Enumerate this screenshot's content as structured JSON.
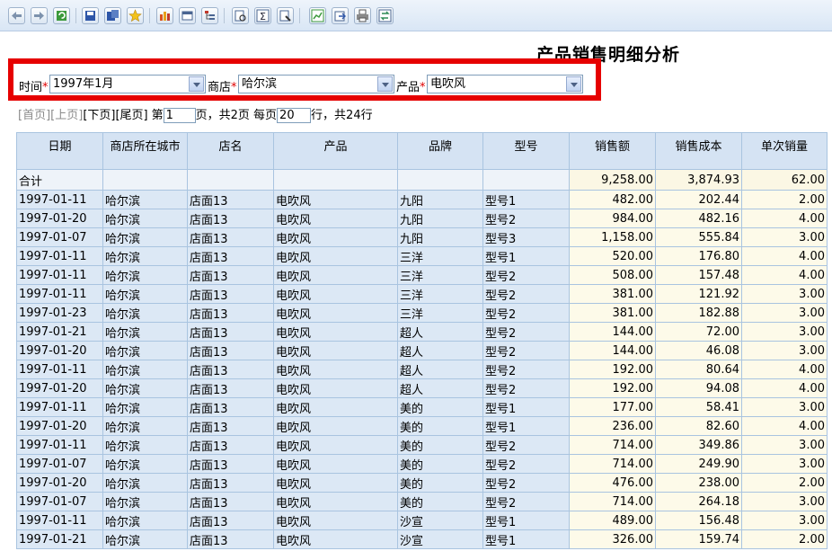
{
  "toolbar": {
    "buttons": [
      "back-icon",
      "forward-icon",
      "refresh-icon",
      "save-icon",
      "save-as-icon",
      "favorite-icon",
      "bar-chart-icon",
      "window-icon",
      "tree-icon",
      "print-preview-icon",
      "sum-icon",
      "query-icon",
      "chart-edit-icon",
      "export-icon",
      "print-icon",
      "swap-icon"
    ]
  },
  "report_title": "产品销售明细分析",
  "filters": {
    "time_label": "时间",
    "time_value": "1997年1月",
    "store_label": "商店",
    "store_value": "哈尔滨",
    "product_label": "产品",
    "product_value": "电吹风",
    "required_mark": "*"
  },
  "pager": {
    "first": "[首页]",
    "prev": "[上页]",
    "next": "[下页]",
    "last": "[尾页]",
    "page_prefix": "第",
    "current_page": "1",
    "page_suffix": "页，共2页 每页",
    "page_size": "20",
    "rows_suffix": "行，共24行"
  },
  "table": {
    "headers": [
      "日期",
      "商店所在城市",
      "店名",
      "产品",
      "品牌",
      "型号",
      "销售额",
      "销售成本",
      "单次销量"
    ],
    "total": {
      "label": "合计",
      "sales": "9,258.00",
      "cost": "3,874.93",
      "qty": "62.00"
    },
    "rows": [
      [
        "1997-01-11",
        "哈尔滨",
        "店面13",
        "电吹风",
        "九阳",
        "型号1",
        "482.00",
        "202.44",
        "2.00"
      ],
      [
        "1997-01-20",
        "哈尔滨",
        "店面13",
        "电吹风",
        "九阳",
        "型号2",
        "984.00",
        "482.16",
        "4.00"
      ],
      [
        "1997-01-07",
        "哈尔滨",
        "店面13",
        "电吹风",
        "九阳",
        "型号3",
        "1,158.00",
        "555.84",
        "3.00"
      ],
      [
        "1997-01-11",
        "哈尔滨",
        "店面13",
        "电吹风",
        "三洋",
        "型号1",
        "520.00",
        "176.80",
        "4.00"
      ],
      [
        "1997-01-11",
        "哈尔滨",
        "店面13",
        "电吹风",
        "三洋",
        "型号2",
        "508.00",
        "157.48",
        "4.00"
      ],
      [
        "1997-01-11",
        "哈尔滨",
        "店面13",
        "电吹风",
        "三洋",
        "型号2",
        "381.00",
        "121.92",
        "3.00"
      ],
      [
        "1997-01-23",
        "哈尔滨",
        "店面13",
        "电吹风",
        "三洋",
        "型号2",
        "381.00",
        "182.88",
        "3.00"
      ],
      [
        "1997-01-21",
        "哈尔滨",
        "店面13",
        "电吹风",
        "超人",
        "型号2",
        "144.00",
        "72.00",
        "3.00"
      ],
      [
        "1997-01-20",
        "哈尔滨",
        "店面13",
        "电吹风",
        "超人",
        "型号2",
        "144.00",
        "46.08",
        "3.00"
      ],
      [
        "1997-01-11",
        "哈尔滨",
        "店面13",
        "电吹风",
        "超人",
        "型号2",
        "192.00",
        "80.64",
        "4.00"
      ],
      [
        "1997-01-20",
        "哈尔滨",
        "店面13",
        "电吹风",
        "超人",
        "型号2",
        "192.00",
        "94.08",
        "4.00"
      ],
      [
        "1997-01-11",
        "哈尔滨",
        "店面13",
        "电吹风",
        "美的",
        "型号1",
        "177.00",
        "58.41",
        "3.00"
      ],
      [
        "1997-01-20",
        "哈尔滨",
        "店面13",
        "电吹风",
        "美的",
        "型号1",
        "236.00",
        "82.60",
        "4.00"
      ],
      [
        "1997-01-11",
        "哈尔滨",
        "店面13",
        "电吹风",
        "美的",
        "型号2",
        "714.00",
        "349.86",
        "3.00"
      ],
      [
        "1997-01-07",
        "哈尔滨",
        "店面13",
        "电吹风",
        "美的",
        "型号2",
        "714.00",
        "249.90",
        "3.00"
      ],
      [
        "1997-01-20",
        "哈尔滨",
        "店面13",
        "电吹风",
        "美的",
        "型号2",
        "476.00",
        "238.00",
        "2.00"
      ],
      [
        "1997-01-07",
        "哈尔滨",
        "店面13",
        "电吹风",
        "美的",
        "型号2",
        "714.00",
        "264.18",
        "3.00"
      ],
      [
        "1997-01-11",
        "哈尔滨",
        "店面13",
        "电吹风",
        "沙宣",
        "型号1",
        "489.00",
        "156.48",
        "3.00"
      ],
      [
        "1997-01-21",
        "哈尔滨",
        "店面13",
        "电吹风",
        "沙宣",
        "型号1",
        "326.00",
        "159.74",
        "2.00"
      ]
    ]
  },
  "colors": {
    "highlight_border": "#e60000",
    "header_bg": "#d5e3f3",
    "num_bg": "#fdfae9"
  }
}
